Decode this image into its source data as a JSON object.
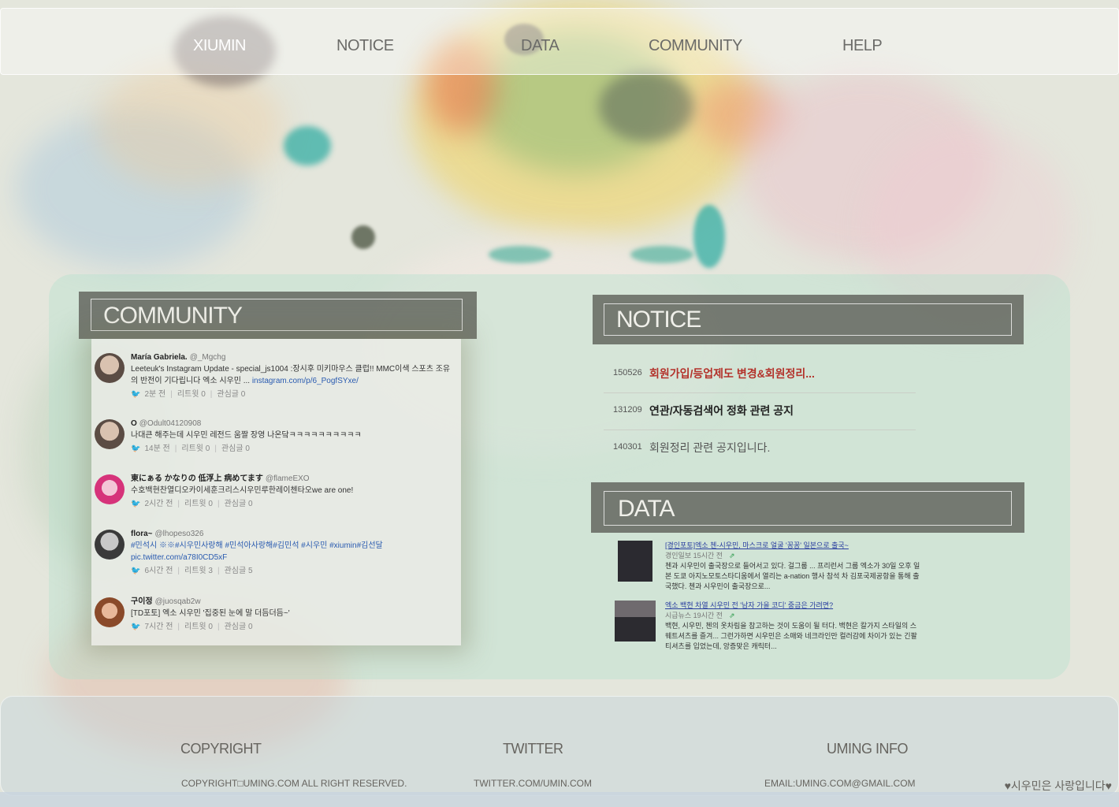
{
  "nav": {
    "items": [
      "XIUMIN",
      "NOTICE",
      "DATA",
      "COMMUNITY",
      "HELP"
    ],
    "active": "XIUMIN"
  },
  "community": {
    "title": "COMMUNITY",
    "tweets": [
      {
        "name": "María Gabriela.",
        "handle": "@_Mgchg",
        "text": "Leeteuk's Instagram Update - special_js1004 :장시후 미키마우스 클럽!! MMC이색 스포츠 조유의 반전이 기다립니다 엑소 시우민 ...",
        "link": "instagram.com/p/6_PogfSYxe/",
        "time": "2분 전",
        "retweets": "리트윗 0",
        "likes": "관심글 0"
      },
      {
        "name": "O",
        "handle": "@Odult04120908",
        "text": "나대큰 해주는데 시우민 레전드 움짤 장영 나온닼ㅋㅋㅋㅋㅋㅋㅋㅋㅋㅋ",
        "link": "",
        "time": "14분 전",
        "retweets": "리트윗 0",
        "likes": "관심글 0"
      },
      {
        "name": "東にぁる かなりの 低浮上 病めてます",
        "handle": "@flameEXO",
        "text": "수호백현찬열디오카이세훈크리스시우민루한레이첸타오we are one!",
        "link": "",
        "time": "2시간 전",
        "retweets": "리트윗 0",
        "likes": "관심글 0"
      },
      {
        "name": "flora~",
        "handle": "@lhopeso326",
        "text": "#민석시 ※※#시우민사랑해 #민석아사랑해#김민석 #시우민 #xiumin#김선달pic.twitter.com/a78I0CD5xF",
        "link": "",
        "time": "6시간 전",
        "retweets": "리트윗 3",
        "likes": "관심글 5"
      },
      {
        "name": "구이정",
        "handle": "@juosqab2w",
        "text": "[TD포토] 엑소 시우민 '집중된 눈에 말 더듬더듬~'",
        "link": "",
        "time": "7시간 전",
        "retweets": "리트윗 0",
        "likes": "관심글 0"
      }
    ]
  },
  "notice": {
    "title": "NOTICE",
    "rows": [
      {
        "date": "150526",
        "title": "회원가입/등업제도 변경&회원정리..."
      },
      {
        "date": "131209",
        "title": "연관/자동검색어 정화 관련 공지"
      },
      {
        "date": "140301",
        "title": "회원정리 관련 공지입니다."
      }
    ]
  },
  "data_section": {
    "title": "DATA",
    "items": [
      {
        "headline": "[경인포토]엑소 첸-시우민, 마스크로 얼굴 '꽁꽁' 일본으로 출국~",
        "source": "경인일보",
        "time": "15시간 전",
        "summary": "첸과 시우민이 출국장으로 들어서고 있다. 걸그룹 ... 프리런서 그룹 엑소가 30일 오후 일본 도쿄 아지노모토스타디움에서 열리는 a-nation 행사 참석 차 김포국제공항을 통해 출국했다. 첸과 시우민이 출국장으로..."
      },
      {
        "headline": "엑소 백현 차열 시우민 전 '남자 가을 코디' 중금은 가려면?",
        "source": "시급뉴스",
        "time": "19시간 전",
        "summary": "백현, 시우민, 첸의 옷차림을 참고하는 것이 도움이 될 터다. 백현은 칼가지 스타일의 스웨트셔츠를 즐겨... 그런가하면 시우민은 소매와 네크라인만 컬러감에 차이가 있는 긴팔 티셔츠를 입었는데, 앙증맞은 캐릭터..."
      }
    ]
  },
  "footer": {
    "copyright_label": "COPYRIGHT",
    "copyright_text": "COPYRIGHT□UMING.COM ALL RIGHT RESERVED.",
    "twitter_label": "TWITTER",
    "twitter_text": "TWITTER.COM/UMIN.COM",
    "info_label": "UMING INFO",
    "info_text": "EMAIL:UMING.COM@GMAIL.COM",
    "tagline": "♥시우민은 사랑입니다♥"
  },
  "colors": {
    "header_bg": "#5f625a",
    "notice_red": "#b3312a",
    "link_blue": "#2a5bb0",
    "twitter_blue": "#2aa3e0"
  }
}
